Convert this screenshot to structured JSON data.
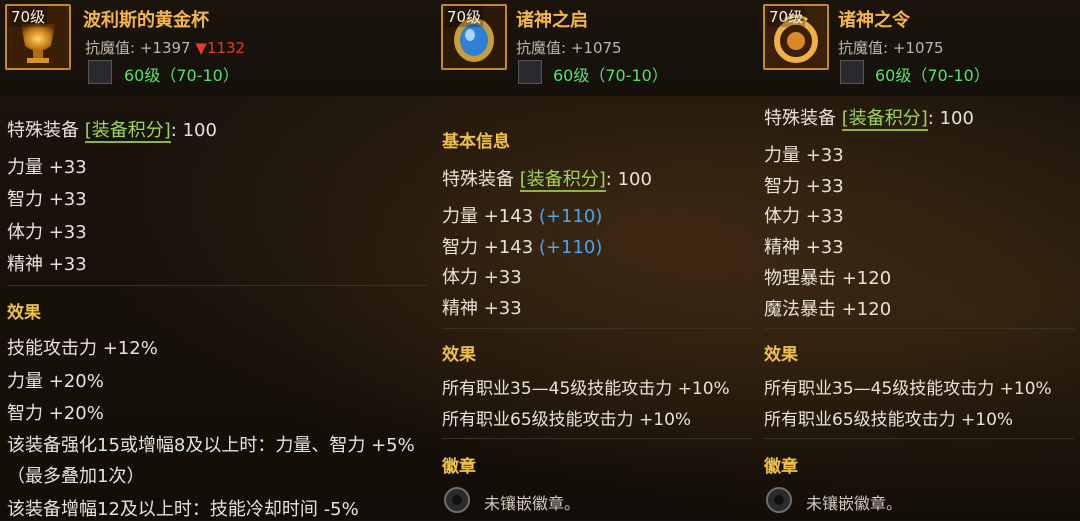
{
  "items": [
    {
      "level": "70级",
      "name": "波利斯的黄金杯",
      "stat_label": "抗魔值:",
      "stat_value": "+1397",
      "stat_change": "▼1132",
      "grade": "60级（70-10）",
      "special_label": "特殊装备",
      "score_tag": "[装备积分]",
      "score_value": ": 100",
      "attrs": [
        "力量 +33",
        "智力 +33",
        "体力 +33",
        "精神 +33"
      ],
      "effect_title": "效果",
      "effects": [
        "技能攻击力 +12%",
        "力量 +20%",
        "智力 +20%",
        "该装备强化15或增幅8及以上时：力量、智力 +5%",
        "（最多叠加1次）",
        "该装备增幅12及以上时：技能冷却时间 -5%"
      ]
    },
    {
      "level": "70级",
      "name": "诸神之启",
      "stat_label": "抗魔值:",
      "stat_value": "+1075",
      "grade": "60级（70-10）",
      "basic_title": "基本信息",
      "special_label": "特殊装备",
      "score_tag": "[装备积分]",
      "score_value": ": 100",
      "attrs": [
        {
          "text": "力量 +143",
          "bonus": "(+110)"
        },
        {
          "text": "智力 +143",
          "bonus": "(+110)"
        },
        {
          "text": "体力 +33",
          "bonus": ""
        },
        {
          "text": "精神 +33",
          "bonus": ""
        }
      ],
      "effect_title": "效果",
      "effects": [
        "所有职业35—45级技能攻击力 +10%",
        "所有职业65级技能攻击力 +10%"
      ],
      "badge_title": "徽章",
      "badge_text": "未镶嵌徽章。"
    },
    {
      "level": "70级",
      "name": "诸神之令",
      "stat_label": "抗魔值:",
      "stat_value": "+1075",
      "grade": "60级（70-10）",
      "special_label": "特殊装备",
      "score_tag": "[装备积分]",
      "score_value": ": 100",
      "attrs": [
        "力量 +33",
        "智力 +33",
        "体力 +33",
        "精神 +33",
        "物理暴击 +120",
        "魔法暴击 +120"
      ],
      "effect_title": "效果",
      "effects": [
        "所有职业35—45级技能攻击力 +10%",
        "所有职业65级技能攻击力 +10%"
      ],
      "badge_title": "徽章",
      "badge_text": "未镶嵌徽章。"
    }
  ],
  "colors": {
    "name": "#f4b64a",
    "grade": "#56e06b",
    "section": "#f0c14a",
    "bonus": "#4aa4f0",
    "decrease": "#e33a2c",
    "tag": "#9fd454"
  }
}
